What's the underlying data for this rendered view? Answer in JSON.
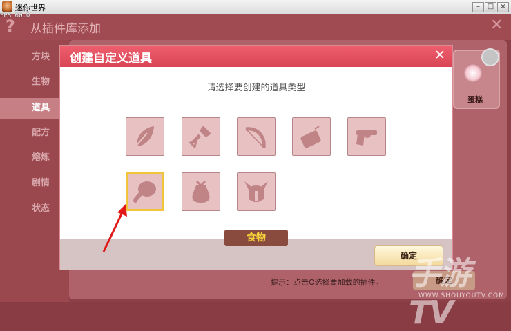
{
  "window": {
    "title": "迷你世界",
    "fps": "FPS 60.0",
    "controls": {
      "minimize": "–",
      "maximize": "□",
      "close": "×"
    }
  },
  "background_panel": {
    "help_icon": "?",
    "title": "从插件库添加",
    "close": "✕",
    "sidebar": [
      {
        "label": "方块",
        "active": false
      },
      {
        "label": "生物",
        "active": false
      },
      {
        "label": "道具",
        "active": true
      },
      {
        "label": "配方",
        "active": false
      },
      {
        "label": "熔炼",
        "active": false
      },
      {
        "label": "剧情",
        "active": false
      },
      {
        "label": "状态",
        "active": false
      }
    ],
    "card": {
      "label": "蛋糕"
    },
    "tip": "提示：点击O选择要加载的插件。",
    "confirm_partial": "确定"
  },
  "dialog": {
    "title": "创建自定义道具",
    "close": "✕",
    "prompt": "请选择要创建的道具类型",
    "types": [
      {
        "icon": "feather-icon"
      },
      {
        "icon": "shovel-icon"
      },
      {
        "icon": "bow-icon"
      },
      {
        "icon": "dynamite-icon"
      },
      {
        "icon": "revolver-icon"
      },
      {
        "icon": "meat-drumstick-icon",
        "selected": true
      },
      {
        "icon": "sack-icon"
      },
      {
        "icon": "horned-helmet-icon"
      }
    ],
    "selected_label": "食物",
    "confirm": "确定"
  },
  "watermark": {
    "text": "手游TV",
    "sub": "WWW.SHOUYOUTV.COM"
  },
  "colors": {
    "dialog_header": "#e14f5e",
    "tile": "#e8c2c3",
    "selected_border": "#f2c43a",
    "arrow": "#e01818"
  }
}
